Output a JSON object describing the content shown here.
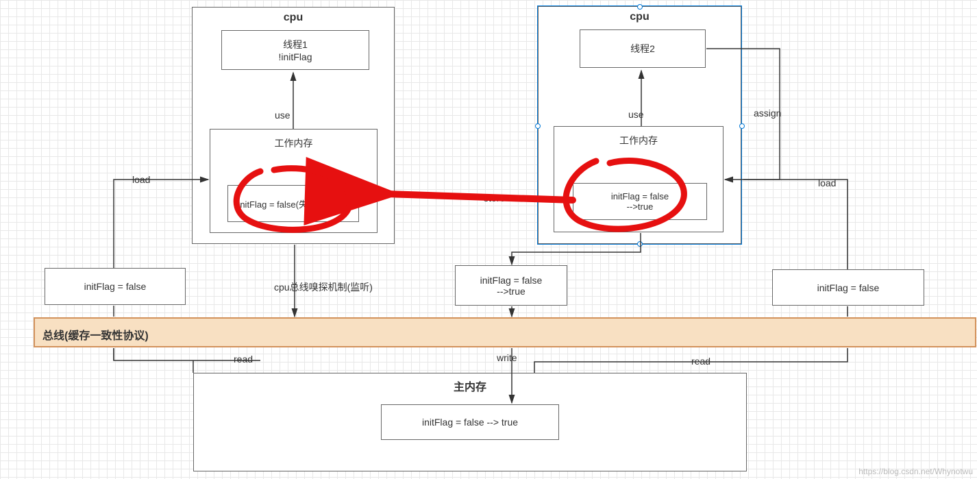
{
  "cpu1": {
    "title": "cpu",
    "thread": "线程1\n!initFlag",
    "use_label": "use",
    "workmem_title": "工作内存",
    "workmem_value": "initFlag = false(失效) -->true"
  },
  "cpu2": {
    "title": "cpu",
    "thread": "线程2",
    "use_label": "use",
    "assign_label": "assign",
    "workmem_title": "工作内存",
    "workmem_value": "initFlag = false\n-->true"
  },
  "left_cache": "initFlag = false",
  "right_cache": "initFlag = false",
  "load_left": "load",
  "load_right": "load",
  "store_label": "store",
  "snoop_label": "cpu总线嗅探机制(监听)",
  "bus_label": "总线(缓存一致性协议)",
  "mid_box": "initFlag = false\n-->true",
  "read_left": "read",
  "read_right": "read",
  "write_label": "write",
  "mainmem_title": "主内存",
  "mainmem_value": "initFlag = false --> true",
  "watermark": "https://blog.csdn.net/Whynotwu"
}
